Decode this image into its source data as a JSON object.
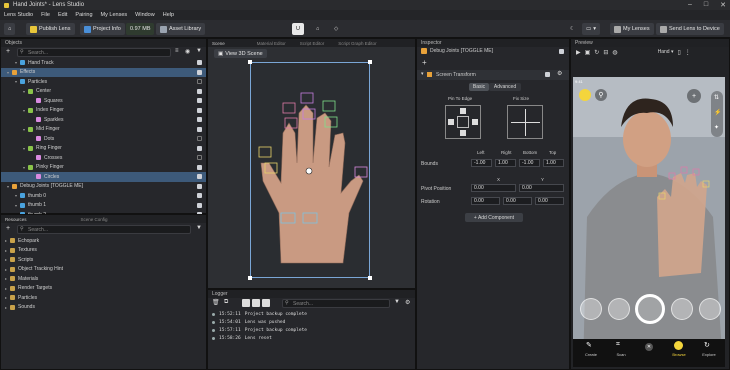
{
  "window": {
    "title": "Hand Joints* - Lens Studio"
  },
  "menu": [
    "Lens Studio",
    "File",
    "Edit",
    "Pairing",
    "My Lenses",
    "Window",
    "Help"
  ],
  "toolbar": {
    "publish": "Publish Lens",
    "project_info": "Project Info",
    "size": "0.97 MB",
    "asset_library": "Asset Library",
    "my_lenses": "My Lenses",
    "send_lens": "Send Lens to Device"
  },
  "objects": {
    "header": "Objects",
    "search_placeholder": "Search...",
    "tree": [
      {
        "label": "Hand Track",
        "indent": 1,
        "checked": true
      },
      {
        "label": "Effects",
        "indent": 0,
        "checked": true,
        "selected": true
      },
      {
        "label": "Particles",
        "indent": 1,
        "checked": false
      },
      {
        "label": "Center",
        "indent": 2,
        "checked": true
      },
      {
        "label": "Squares",
        "indent": 3,
        "checked": true
      },
      {
        "label": "Index Finger",
        "indent": 2,
        "checked": true
      },
      {
        "label": "Sparkles",
        "indent": 3,
        "checked": true
      },
      {
        "label": "Mid Finger",
        "indent": 2,
        "checked": true
      },
      {
        "label": "Dots",
        "indent": 3,
        "checked": false
      },
      {
        "label": "Ring Finger",
        "indent": 2,
        "checked": true
      },
      {
        "label": "Crosses",
        "indent": 3,
        "checked": false
      },
      {
        "label": "Pinky Finger",
        "indent": 2,
        "checked": true
      },
      {
        "label": "Circles",
        "indent": 3,
        "checked": true,
        "selected": true
      },
      {
        "label": "Debug Joints [TOGGLE ME]",
        "indent": 0,
        "checked": true
      },
      {
        "label": "thumb 0",
        "indent": 1,
        "checked": true
      },
      {
        "label": "thumb 1",
        "indent": 1,
        "checked": true
      },
      {
        "label": "thumb 2",
        "indent": 1,
        "checked": true
      }
    ]
  },
  "resources": {
    "tab1": "Resources",
    "tab2": "Scene Config",
    "search_placeholder": "Search...",
    "items": [
      "Echopark",
      "Textures",
      "Scripts",
      "Object Tracking Hint",
      "Materials",
      "Render Targets",
      "Particles",
      "Sounds"
    ]
  },
  "scene": {
    "tabs": [
      "Scene",
      "Material Editor",
      "Script Editor",
      "Script Graph Editor"
    ],
    "view_btn": "View 3D Scene"
  },
  "logger": {
    "header": "Logger",
    "search_placeholder": "Search...",
    "entries": [
      {
        "time": "15:52:11",
        "msg": "Project backup complete"
      },
      {
        "time": "15:54:01",
        "msg": "Lens was pushed"
      },
      {
        "time": "15:57:11",
        "msg": "Project backup complete"
      },
      {
        "time": "15:58:26",
        "msg": "Lens reset"
      }
    ]
  },
  "inspector": {
    "header": "Inspector",
    "object_name": "Debug Joints [TOGGLE ME]",
    "component": "Screen Transform",
    "tab_basic": "Basic",
    "tab_advanced": "Advanced",
    "pin_label": "Pin To Edge",
    "fix_label": "Fix Size",
    "cols": [
      "Left",
      "Right",
      "Bottom",
      "Top"
    ],
    "bounds_label": "Bounds",
    "bounds": [
      "-1.00",
      "1.00",
      "-1.00",
      "1.00"
    ],
    "xy": [
      "X",
      "Y"
    ],
    "pivot_label": "Pivot Position",
    "pivot": [
      "0.00",
      "0.00"
    ],
    "rotation_label": "Rotation",
    "rotation": [
      "0.00",
      "0.00",
      "0.00"
    ],
    "add_component": "+ Add Component"
  },
  "preview": {
    "header": "Preview",
    "dropdown": "Hand",
    "status_time": "9:41",
    "nav": [
      "Create",
      "Scan",
      "",
      "Browse",
      "Explore"
    ]
  }
}
